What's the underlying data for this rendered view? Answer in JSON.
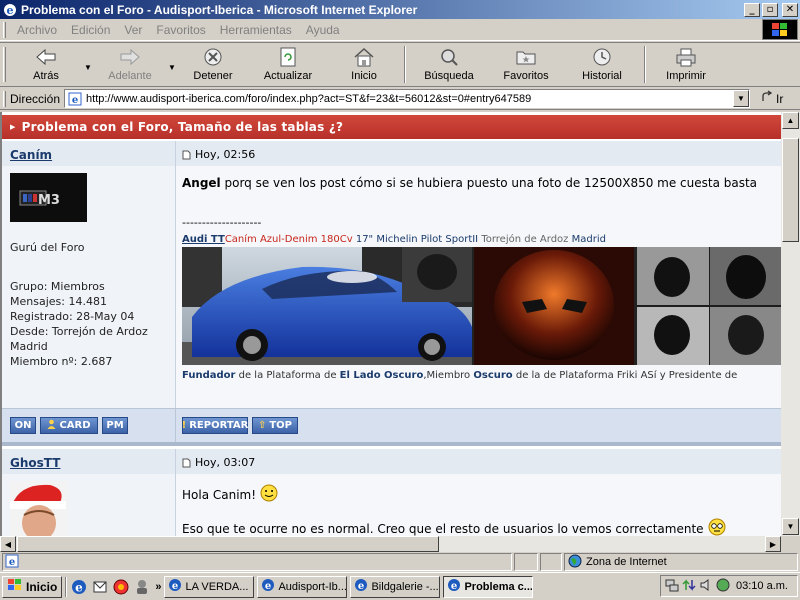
{
  "window": {
    "title": "Problema con el Foro - Audisport-Iberica - Microsoft Internet Explorer"
  },
  "menu": [
    "Archivo",
    "Edición",
    "Ver",
    "Favoritos",
    "Herramientas",
    "Ayuda"
  ],
  "toolbar": {
    "back": "Atrás",
    "forward": "Adelante",
    "stop": "Detener",
    "refresh": "Actualizar",
    "home": "Inicio",
    "search": "Búsqueda",
    "favorites": "Favoritos",
    "history": "Historial",
    "print": "Imprimir"
  },
  "address": {
    "label": "Dirección",
    "url": "http://www.audisport-iberica.com/foro/index.php?act=ST&f=23&t=56012&st=0#entry647589",
    "go": "Ir"
  },
  "thread": {
    "title": "Problema con el Foro, Tamaño de las tablas ¿?"
  },
  "posts": [
    {
      "author": "Caním",
      "date": "Hoy, 02:56",
      "avatar_text": "M3",
      "rank": "Gurú del Foro",
      "group": "Grupo: Miembros",
      "posts": "Mensajes: 14.481",
      "registered": "Registrado: 28-May 04",
      "from_line1": "Desde: Torrejón de Ardoz",
      "from_line2": "Madrid",
      "member_no": "Miembro nº: 2.687",
      "body_name": "Angel",
      "body_text": " porq se ven los post cómo si se hubiera puesto una foto de 12500X850 me cuesta basta",
      "sig_dashes": "--------------------",
      "sig_audi": "Audi TT",
      "sig_canim": "Caním Azul-Denim 180Cv",
      "sig_tyres": " 17\" Michelin Pilot SportII ",
      "sig_place": "Torrejón de Ardoz",
      "sig_city": " Madrid",
      "sig2_a": "Fundador",
      "sig2_b": " de la Plataforma de ",
      "sig2_c": "El Lado Oscuro",
      "sig2_d": ",Miembro ",
      "sig2_e": "Oscuro",
      "sig2_f": " de la de Plataforma Friki ASí y Presidente de",
      "buttons": {
        "on": "ON",
        "card": "CARD",
        "pm": "PM",
        "report": "REPORTAR",
        "top": "TOP"
      }
    },
    {
      "author": "GhosTT",
      "date": "Hoy, 03:07",
      "line1": "Hola Canim! ",
      "line2": "Eso que te ocurre no es normal. Creo que el resto de usuarios lo vemos correctamente "
    }
  ],
  "status": {
    "zone": "Zona de Internet"
  },
  "taskbar": {
    "start": "Inicio",
    "tasks": [
      "LA VERDA...",
      "Audisport-Ib...",
      "Bildgalerie -...",
      "Problema c..."
    ],
    "clock": "03:10 a.m."
  },
  "colors": {
    "title_bar": "#0a246a",
    "thread_header": "#c23a32",
    "post_header": "#e4eaf2",
    "button_blue": "#3c63a8",
    "sig_red": "#c8261c"
  }
}
